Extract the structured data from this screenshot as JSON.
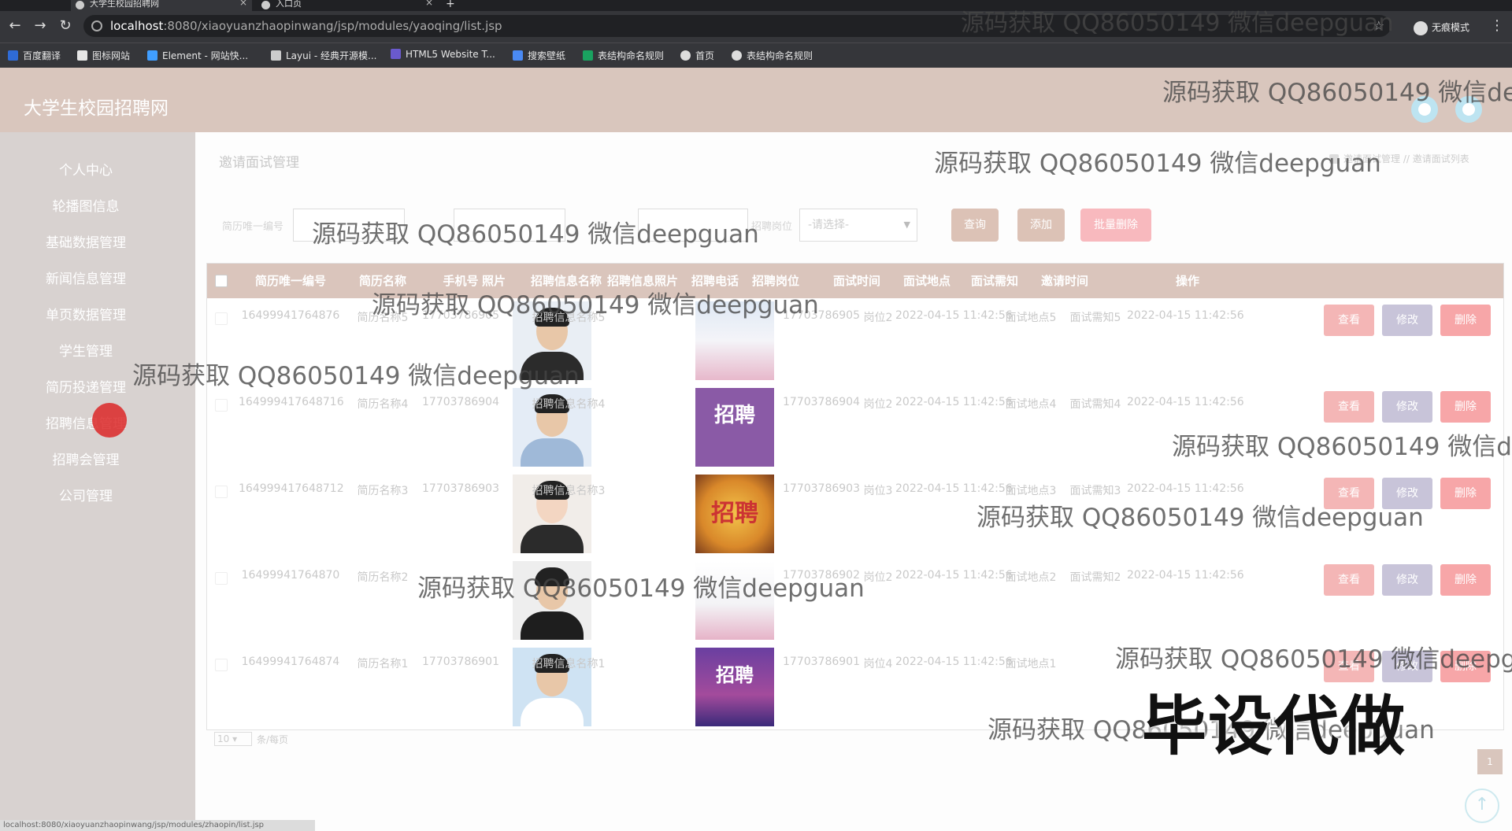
{
  "browser": {
    "tabs": [
      {
        "title": "大学生校园招聘网"
      },
      {
        "title": "入口页"
      }
    ],
    "url_host": "localhost",
    "url_path": ":8080/xiaoyuanzhaopinwang/jsp/modules/yaoqing/list.jsp",
    "incognito_label": "无痕模式",
    "bookmarks": [
      {
        "label": "百度翻译",
        "color": "#2f6bd6"
      },
      {
        "label": "图标网站",
        "color": "#e6e6e6"
      },
      {
        "label": "Element - 网站快...",
        "color": "#409eff"
      },
      {
        "label": "Layui - 经典开源模...",
        "color": "#cccccc"
      },
      {
        "label": "HTML5 Website T...",
        "color": "#6a5acd"
      },
      {
        "label": "搜索壁纸",
        "color": "#4a8af4"
      },
      {
        "label": "表结构命名规则",
        "color": "#1aa260"
      },
      {
        "label": "首页",
        "color": "#dddddd"
      },
      {
        "label": "表结构命名规则",
        "color": "#dddddd"
      }
    ]
  },
  "app": {
    "title": "大学生校园招聘网",
    "header_color": "#d9c6bd"
  },
  "sidebar": {
    "items": [
      {
        "label": "个人中心"
      },
      {
        "label": "轮播图信息"
      },
      {
        "label": "基础数据管理"
      },
      {
        "label": "新闻信息管理"
      },
      {
        "label": "单页数据管理"
      },
      {
        "label": "学生管理"
      },
      {
        "label": "简历投递管理"
      },
      {
        "label": "招聘信息管理"
      },
      {
        "label": "招聘会管理"
      },
      {
        "label": "公司管理"
      }
    ]
  },
  "page": {
    "title": "邀请面试管理",
    "breadcrumb": "邀请面试管理 // 邀请面试列表"
  },
  "search": {
    "label_resume_id": "简历唯一编号",
    "label_position": "招聘岗位",
    "select_placeholder": "-请选择-",
    "query_button": "查询",
    "add_button": "添加",
    "batch_delete_button": "批量删除"
  },
  "table": {
    "headers": [
      "简历唯一编号",
      "简历名称",
      "手机号",
      "照片",
      "招聘信息名称",
      "招聘信息照片",
      "招聘电话",
      "招聘岗位",
      "面试时间",
      "面试地点",
      "面试需知",
      "邀请时间",
      "操作"
    ],
    "rows": [
      {
        "resume_id": "16499941764876",
        "resume_name": "简历名称5",
        "phone": "17703786905",
        "job_name": "招聘信息名称5",
        "job_phone": "17703786905",
        "position": "岗位2",
        "interview_time": "2022-04-15 11:42:56",
        "place": "面试地点5",
        "notice": "面试需知5",
        "invite_time": "2022-04-15 11:42:56"
      },
      {
        "resume_id": "164999417648716",
        "resume_name": "简历名称4",
        "phone": "17703786904",
        "job_name": "招聘信息名称4",
        "job_phone": "17703786904",
        "position": "岗位2",
        "interview_time": "2022-04-15 11:42:56",
        "place": "面试地点4",
        "notice": "面试需知4",
        "invite_time": "2022-04-15 11:42:56"
      },
      {
        "resume_id": "164999417648712",
        "resume_name": "简历名称3",
        "phone": "17703786903",
        "job_name": "招聘信息名称3",
        "job_phone": "17703786903",
        "position": "岗位3",
        "interview_time": "2022-04-15 11:42:56",
        "place": "面试地点3",
        "notice": "面试需知3",
        "invite_time": "2022-04-15 11:42:56"
      },
      {
        "resume_id": "16499941764870",
        "resume_name": "简历名称2",
        "phone": "",
        "job_name": "",
        "job_phone": "17703786902",
        "position": "岗位2",
        "interview_time": "2022-04-15 11:42:56",
        "place": "面试地点2",
        "notice": "面试需知2",
        "invite_time": "2022-04-15 11:42:56"
      },
      {
        "resume_id": "16499941764874",
        "resume_name": "简历名称1",
        "phone": "17703786901",
        "job_name": "招聘信息名称1",
        "job_phone": "17703786901",
        "position": "岗位4",
        "interview_time": "2022-04-15 11:42:56",
        "place": "面试地点1",
        "notice": "",
        "invite_time": ""
      }
    ],
    "action_view": "查看",
    "action_edit": "修改",
    "action_delete": "删除",
    "poster_texts": [
      "招聘",
      "招聘",
      "招聘"
    ]
  },
  "pagination": {
    "page_size": "10",
    "per_page_label": "条/每页",
    "current_page": "1"
  },
  "status_url": "localhost:8080/xiaoyuanzhaopinwang/jsp/modules/zhaopin/list.jsp",
  "overlays": {
    "watermark": "源码获取 QQ86050149 微信deepguan",
    "stamp": "毕设代做"
  },
  "colors": {
    "view_button": "#f4b6b6",
    "edit_button": "#c8c4d9",
    "delete_button": "#f7a6a8",
    "query_button": "#dcc2b6",
    "add_button": "#dcc2b6",
    "batch_delete_button": "#f8b9be"
  }
}
